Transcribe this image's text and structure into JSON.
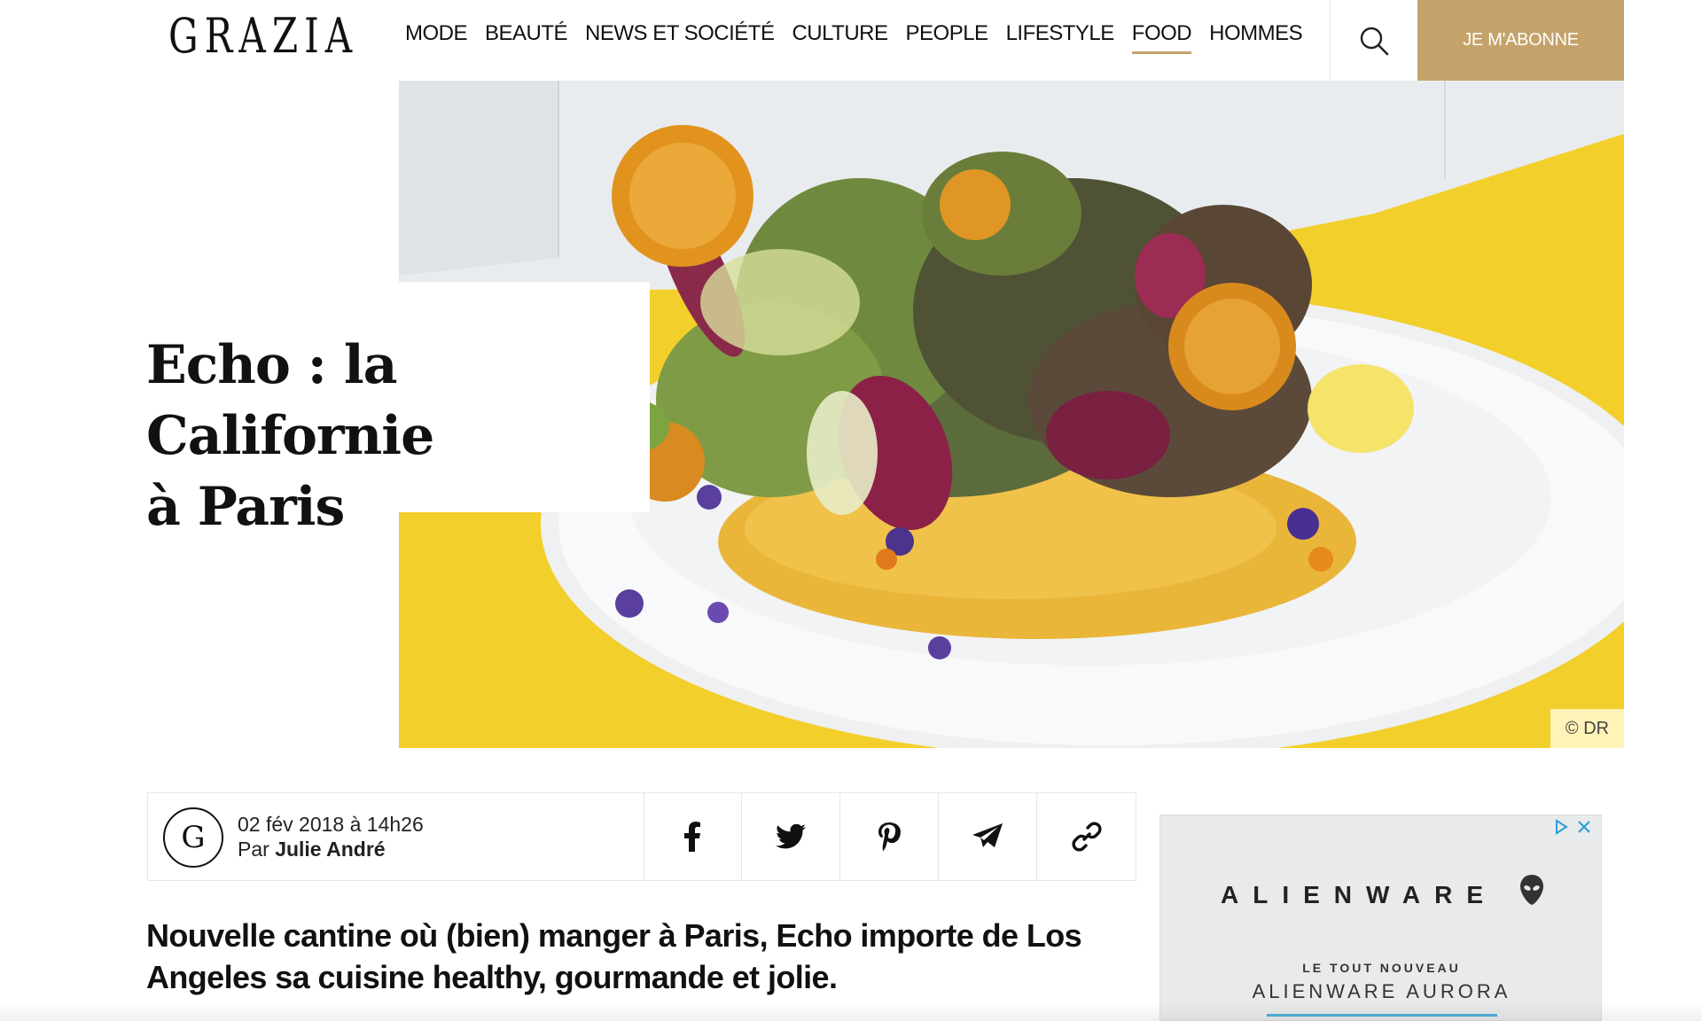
{
  "header": {
    "logo": "GRAZIA",
    "nav": [
      "MODE",
      "BEAUTÉ",
      "NEWS ET SOCIÉTÉ",
      "CULTURE",
      "PEOPLE",
      "LIFESTYLE",
      "FOOD",
      "HOMMES"
    ],
    "active_nav": "FOOD",
    "subscribe_label": "JE M'ABONNE",
    "search_icon": "search-icon",
    "accent_color": "#c4a36a"
  },
  "hero": {
    "title_line1": "Echo : la Californie",
    "title_line2": "à Paris",
    "photo_credit": "© DR",
    "image_description_icon": "salad-plate-photo"
  },
  "article": {
    "avatar_letter": "G",
    "date": "02 fév 2018 à 14h26",
    "by_prefix": "Par",
    "author": "Julie André",
    "share_icons": [
      "facebook-icon",
      "twitter-icon",
      "pinterest-icon",
      "telegram-icon",
      "link-icon"
    ],
    "lead": "Nouvelle cantine où (bien) manger à Paris, Echo importe de Los Angeles sa cuisine healthy, gourmande et jolie."
  },
  "ad": {
    "brand": "ALIENWARE",
    "tagline_small": "LE TOUT NOUVEAU",
    "tagline_big": "ALIENWARE AURORA",
    "icons": [
      "adchoices-icon",
      "close-icon"
    ]
  }
}
